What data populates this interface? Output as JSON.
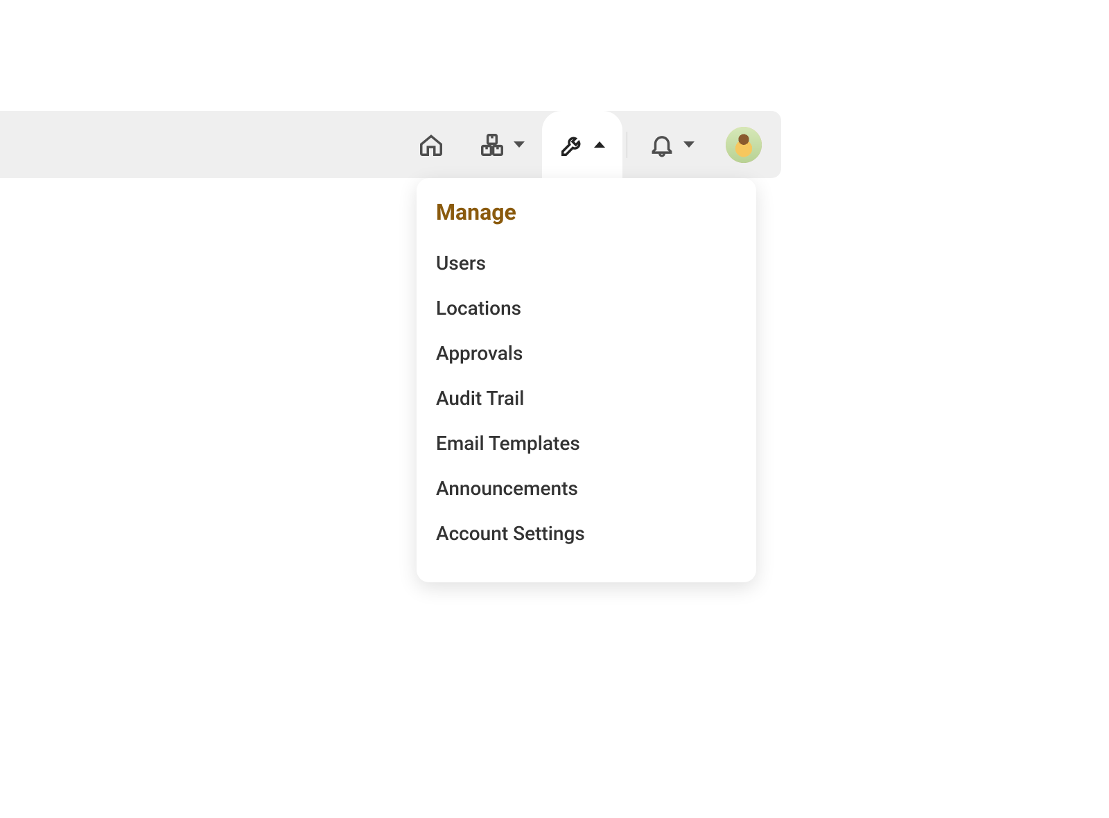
{
  "topbar": {
    "nav": [
      {
        "name": "home",
        "icon": "home-icon",
        "hasCaret": false
      },
      {
        "name": "inventory",
        "icon": "boxes-icon",
        "hasCaret": true,
        "caretDir": "down"
      },
      {
        "name": "manage",
        "icon": "wrench-icon",
        "hasCaret": true,
        "caretDir": "up",
        "active": true
      },
      {
        "name": "notifications",
        "icon": "bell-icon",
        "hasCaret": true,
        "caretDir": "down",
        "afterDivider": true
      }
    ]
  },
  "dropdown": {
    "header": "Manage",
    "items": [
      {
        "label": "Users"
      },
      {
        "label": "Locations"
      },
      {
        "label": "Approvals"
      },
      {
        "label": "Audit Trail"
      },
      {
        "label": "Email Templates"
      },
      {
        "label": "Announcements"
      },
      {
        "label": "Account Settings"
      }
    ]
  },
  "colors": {
    "accent": "#8a5a0d",
    "topbarBg": "#efefef",
    "iconStroke": "#4e4e4e"
  }
}
